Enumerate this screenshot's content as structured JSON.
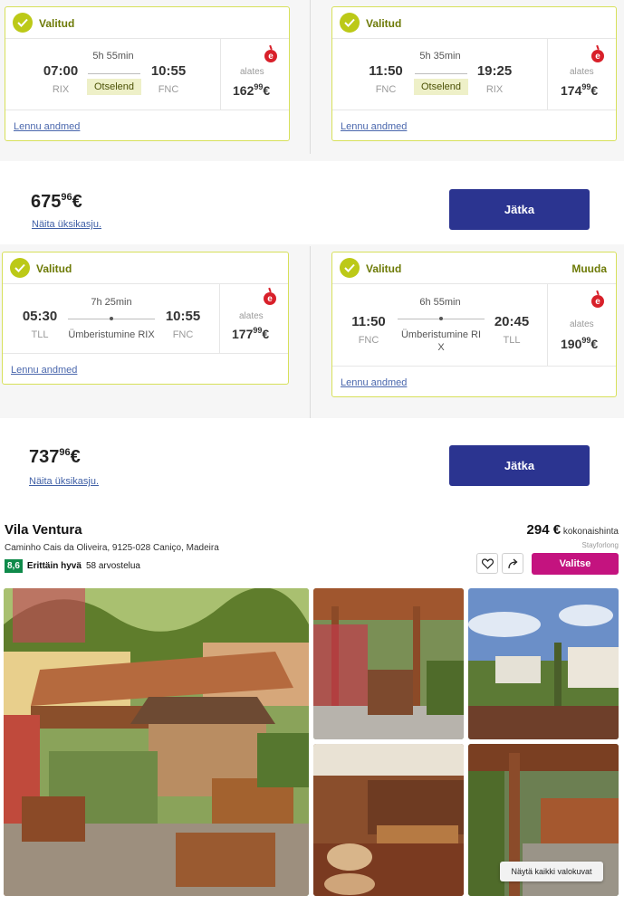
{
  "packages": [
    {
      "total_main": "675",
      "total_cents": "96",
      "currency": "€",
      "unit_link": "Näita üksikasju.",
      "continue_label": "Jätka",
      "outbound": {
        "status": "Valitud",
        "dep_time": "07:00",
        "dep_code": "RIX",
        "duration": "5h 55min",
        "stops": "Otselend",
        "arr_time": "10:55",
        "arr_code": "FNC",
        "from_label": "alates",
        "price_main": "162",
        "price_cents": "99",
        "price_currency": "€",
        "details": "Lennu andmed"
      },
      "inbound": {
        "status": "Valitud",
        "dep_time": "11:50",
        "dep_code": "FNC",
        "duration": "5h 35min",
        "stops": "Otselend",
        "arr_time": "19:25",
        "arr_code": "RIX",
        "from_label": "alates",
        "price_main": "174",
        "price_cents": "99",
        "price_currency": "€",
        "details": "Lennu andmed"
      }
    },
    {
      "total_main": "737",
      "total_cents": "96",
      "currency": "€",
      "unit_link": "Näita üksikasju.",
      "continue_label": "Jätka",
      "outbound": {
        "status": "Valitud",
        "dep_time": "05:30",
        "dep_code": "TLL",
        "duration": "7h 25min",
        "stops": "Ümberistumine RIX",
        "arr_time": "10:55",
        "arr_code": "FNC",
        "from_label": "alates",
        "price_main": "177",
        "price_cents": "99",
        "price_currency": "€",
        "details": "Lennu andmed"
      },
      "inbound": {
        "status": "Valitud",
        "change": "Muuda",
        "dep_time": "11:50",
        "dep_code": "FNC",
        "duration": "6h 55min",
        "stops_line1": "Ümberistumine RI",
        "stops_line2": "X",
        "arr_time": "20:45",
        "arr_code": "TLL",
        "from_label": "alates",
        "price_main": "190",
        "price_cents": "99",
        "price_currency": "€",
        "details": "Lennu andmed"
      }
    }
  ],
  "airline_icon": "airline-logo-icon",
  "airline_letter": "e",
  "hotel": {
    "name": "Vila Ventura",
    "address": "Caminho Cais da Oliveira, 9125-028 Caniço, Madeira",
    "score": "8,6",
    "rating_word": "Erittäin hyvä",
    "reviews": "58 arvostelua",
    "price": "294 €",
    "price_note": "kokonaishinta",
    "supplier": "Stayforlong",
    "select_label": "Valitse",
    "show_all_photos": "Näytä kaikki valokuvat"
  },
  "colors": {
    "accent_yellow": "#bcc917",
    "continue_blue": "#2b3490",
    "select_pink": "#c4137f",
    "score_green": "#0f8a4a"
  }
}
